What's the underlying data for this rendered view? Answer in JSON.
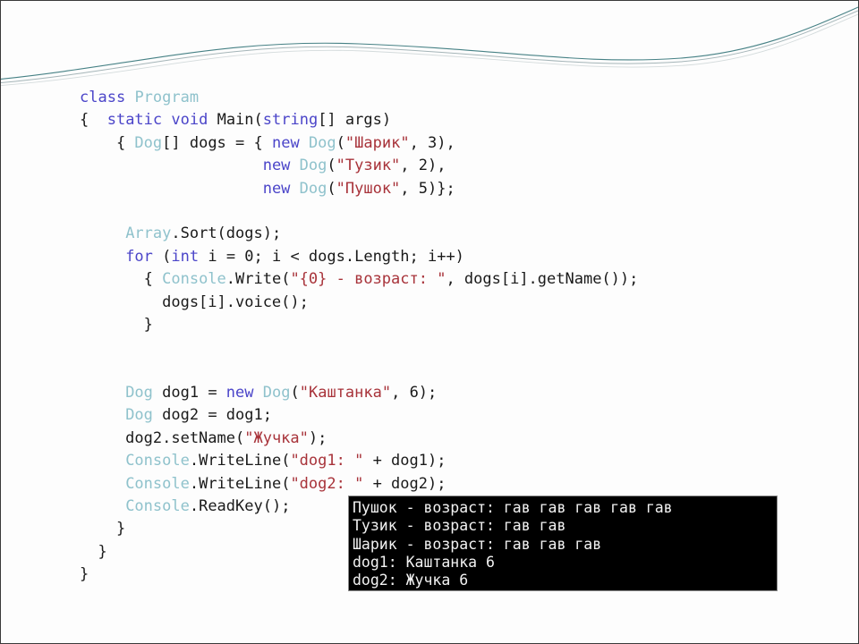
{
  "slide": {
    "background_color": "#fdfdfd",
    "border_color": "#3a3a3a"
  },
  "decoration": {
    "name": "wave-ribbon",
    "stroke_color_primary": "#3c7a7e",
    "stroke_color_secondary": "#9aa8ab"
  },
  "theme": {
    "keyword_color": "#4b45c9",
    "type_color": "#8fc2cc",
    "string_color": "#a8333a",
    "plain_color": "#1a1a1a",
    "console_background": "#000000",
    "console_foreground": "#f2f2f2"
  },
  "code": {
    "language": "csharp",
    "lines": [
      {
        "indent": 0,
        "tokens": [
          {
            "t": "class",
            "c": "kw"
          },
          {
            "t": " ",
            "c": "pl"
          },
          {
            "t": "Program",
            "c": "typ"
          }
        ]
      },
      {
        "indent": 0,
        "tokens": [
          {
            "t": "{  ",
            "c": "pl"
          },
          {
            "t": "static",
            "c": "kw"
          },
          {
            "t": " ",
            "c": "pl"
          },
          {
            "t": "void",
            "c": "kw"
          },
          {
            "t": " Main(",
            "c": "pl"
          },
          {
            "t": "string",
            "c": "kw"
          },
          {
            "t": "[] args)",
            "c": "pl"
          }
        ]
      },
      {
        "indent": 0,
        "tokens": [
          {
            "t": "    { ",
            "c": "pl"
          },
          {
            "t": "Dog",
            "c": "typ"
          },
          {
            "t": "[] dogs = { ",
            "c": "pl"
          },
          {
            "t": "new",
            "c": "kw"
          },
          {
            "t": " ",
            "c": "pl"
          },
          {
            "t": "Dog",
            "c": "typ"
          },
          {
            "t": "(",
            "c": "pl"
          },
          {
            "t": "\"Шарик\"",
            "c": "str"
          },
          {
            "t": ", 3),",
            "c": "pl"
          }
        ]
      },
      {
        "indent": 0,
        "tokens": [
          {
            "t": "                    ",
            "c": "pl"
          },
          {
            "t": "new",
            "c": "kw"
          },
          {
            "t": " ",
            "c": "pl"
          },
          {
            "t": "Dog",
            "c": "typ"
          },
          {
            "t": "(",
            "c": "pl"
          },
          {
            "t": "\"Тузик\"",
            "c": "str"
          },
          {
            "t": ", 2),",
            "c": "pl"
          }
        ]
      },
      {
        "indent": 0,
        "tokens": [
          {
            "t": "                    ",
            "c": "pl"
          },
          {
            "t": "new",
            "c": "kw"
          },
          {
            "t": " ",
            "c": "pl"
          },
          {
            "t": "Dog",
            "c": "typ"
          },
          {
            "t": "(",
            "c": "pl"
          },
          {
            "t": "\"Пушок\"",
            "c": "str"
          },
          {
            "t": ", 5)};",
            "c": "pl"
          }
        ]
      },
      {
        "indent": 0,
        "tokens": []
      },
      {
        "indent": 0,
        "tokens": [
          {
            "t": "     ",
            "c": "pl"
          },
          {
            "t": "Array",
            "c": "typ"
          },
          {
            "t": ".Sort(dogs);",
            "c": "pl"
          }
        ]
      },
      {
        "indent": 0,
        "tokens": [
          {
            "t": "     ",
            "c": "pl"
          },
          {
            "t": "for",
            "c": "kw"
          },
          {
            "t": " (",
            "c": "pl"
          },
          {
            "t": "int",
            "c": "kw"
          },
          {
            "t": " i = 0; i < dogs.Length; i++)",
            "c": "pl"
          }
        ]
      },
      {
        "indent": 0,
        "tokens": [
          {
            "t": "       { ",
            "c": "pl"
          },
          {
            "t": "Console",
            "c": "typ"
          },
          {
            "t": ".Write(",
            "c": "pl"
          },
          {
            "t": "\"{0} - возраст: \"",
            "c": "str"
          },
          {
            "t": ", dogs[i].getName());",
            "c": "pl"
          }
        ]
      },
      {
        "indent": 0,
        "tokens": [
          {
            "t": "         dogs[i].voice();",
            "c": "pl"
          }
        ]
      },
      {
        "indent": 0,
        "tokens": [
          {
            "t": "       }",
            "c": "pl"
          }
        ]
      },
      {
        "indent": 0,
        "tokens": []
      },
      {
        "indent": 0,
        "tokens": []
      },
      {
        "indent": 0,
        "tokens": [
          {
            "t": "     ",
            "c": "pl"
          },
          {
            "t": "Dog",
            "c": "typ"
          },
          {
            "t": " dog1 = ",
            "c": "pl"
          },
          {
            "t": "new",
            "c": "kw"
          },
          {
            "t": " ",
            "c": "pl"
          },
          {
            "t": "Dog",
            "c": "typ"
          },
          {
            "t": "(",
            "c": "pl"
          },
          {
            "t": "\"Каштанка\"",
            "c": "str"
          },
          {
            "t": ", 6);",
            "c": "pl"
          }
        ]
      },
      {
        "indent": 0,
        "tokens": [
          {
            "t": "     ",
            "c": "pl"
          },
          {
            "t": "Dog",
            "c": "typ"
          },
          {
            "t": " dog2 = dog1;",
            "c": "pl"
          }
        ]
      },
      {
        "indent": 0,
        "tokens": [
          {
            "t": "     dog2.setName(",
            "c": "pl"
          },
          {
            "t": "\"Жучка\"",
            "c": "str"
          },
          {
            "t": ");",
            "c": "pl"
          }
        ]
      },
      {
        "indent": 0,
        "tokens": [
          {
            "t": "     ",
            "c": "pl"
          },
          {
            "t": "Console",
            "c": "typ"
          },
          {
            "t": ".WriteLine(",
            "c": "pl"
          },
          {
            "t": "\"dog1: \"",
            "c": "str"
          },
          {
            "t": " + dog1);",
            "c": "pl"
          }
        ]
      },
      {
        "indent": 0,
        "tokens": [
          {
            "t": "     ",
            "c": "pl"
          },
          {
            "t": "Console",
            "c": "typ"
          },
          {
            "t": ".WriteLine(",
            "c": "pl"
          },
          {
            "t": "\"dog2: \"",
            "c": "str"
          },
          {
            "t": " + dog2);",
            "c": "pl"
          }
        ]
      },
      {
        "indent": 0,
        "tokens": [
          {
            "t": "     ",
            "c": "pl"
          },
          {
            "t": "Console",
            "c": "typ"
          },
          {
            "t": ".ReadKey();",
            "c": "pl"
          }
        ]
      },
      {
        "indent": 0,
        "tokens": [
          {
            "t": "    }",
            "c": "pl"
          }
        ]
      },
      {
        "indent": 0,
        "tokens": [
          {
            "t": "  }",
            "c": "pl"
          }
        ]
      },
      {
        "indent": 0,
        "tokens": [
          {
            "t": "}",
            "c": "pl"
          }
        ]
      }
    ]
  },
  "console": {
    "title": "program-output",
    "lines": [
      "Пушок - возраст: гав гав гав гав гав",
      "Тузик - возраст: гав гав",
      "Шарик - возраст: гав гав гав",
      "dog1: Каштанка 6",
      "dog2: Жучка 6"
    ]
  }
}
